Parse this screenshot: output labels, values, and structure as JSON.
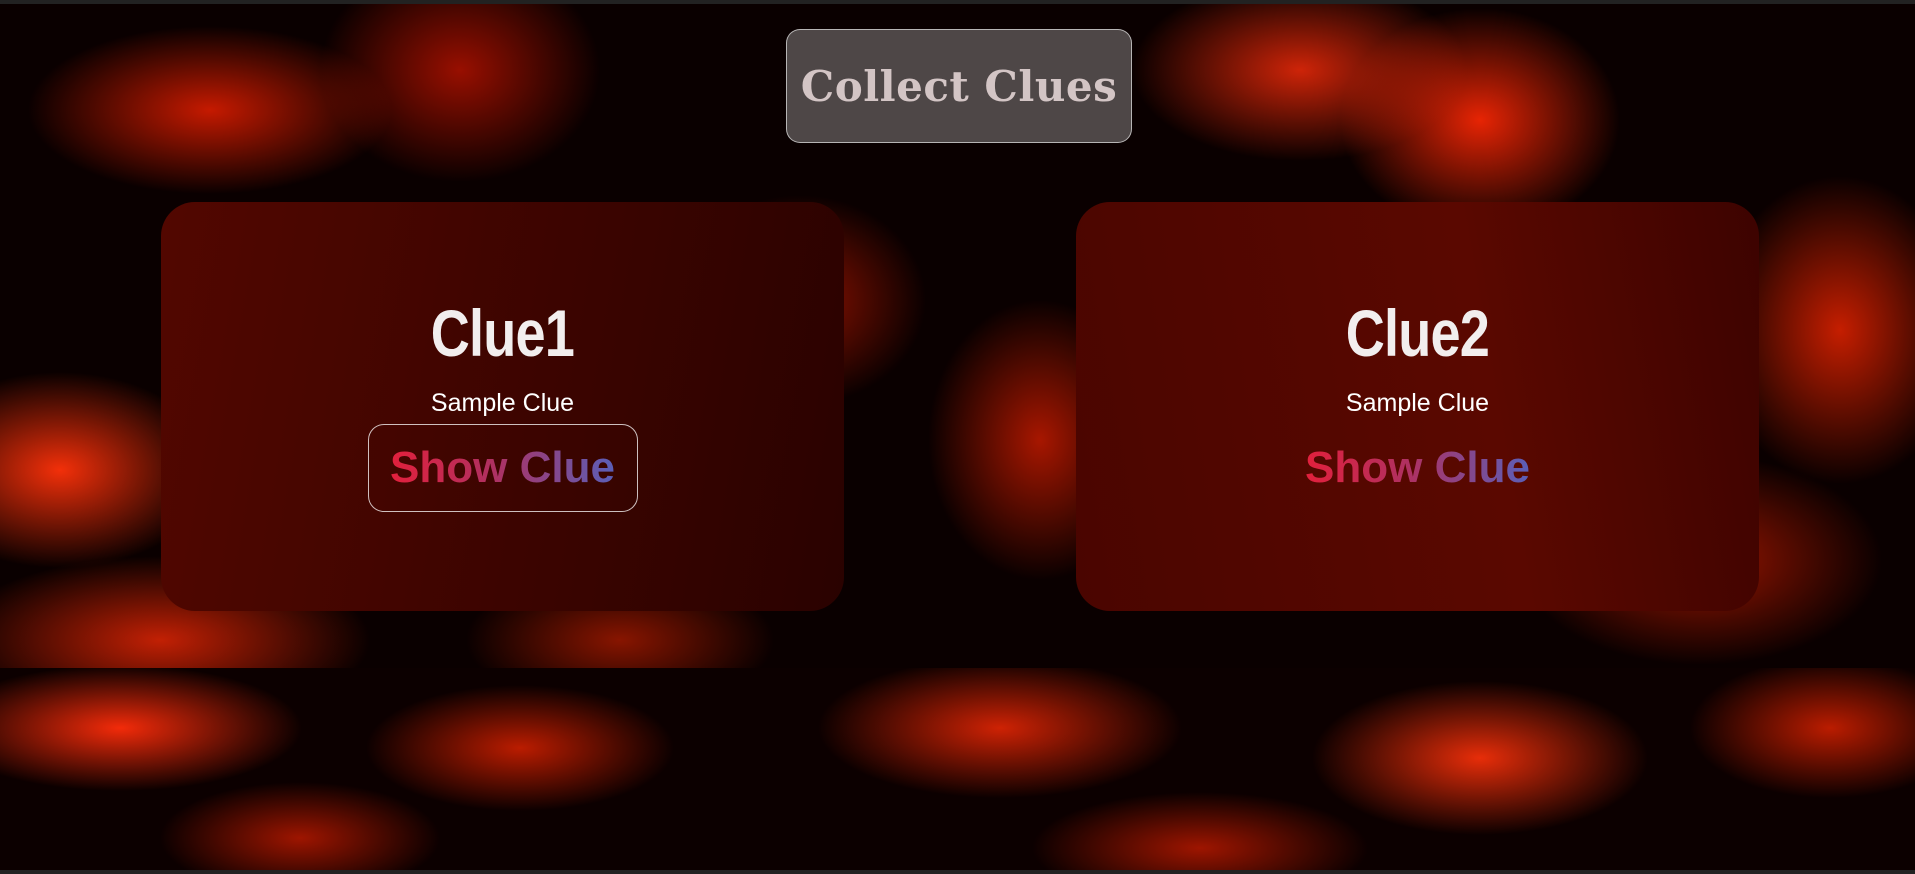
{
  "header": {
    "title": "Collect Clues"
  },
  "cards": [
    {
      "title": "Clue1",
      "body": "Sample Clue",
      "button_label": "Show Clue"
    },
    {
      "title": "Clue2",
      "body": "Sample Clue",
      "button_label": "Show Clue"
    }
  ],
  "colors": {
    "card_background": "#4a0500",
    "button_gradient_start": "#e2203c",
    "button_gradient_end": "#5a5fb8",
    "title_box_border": "#ffffff"
  },
  "icons": []
}
